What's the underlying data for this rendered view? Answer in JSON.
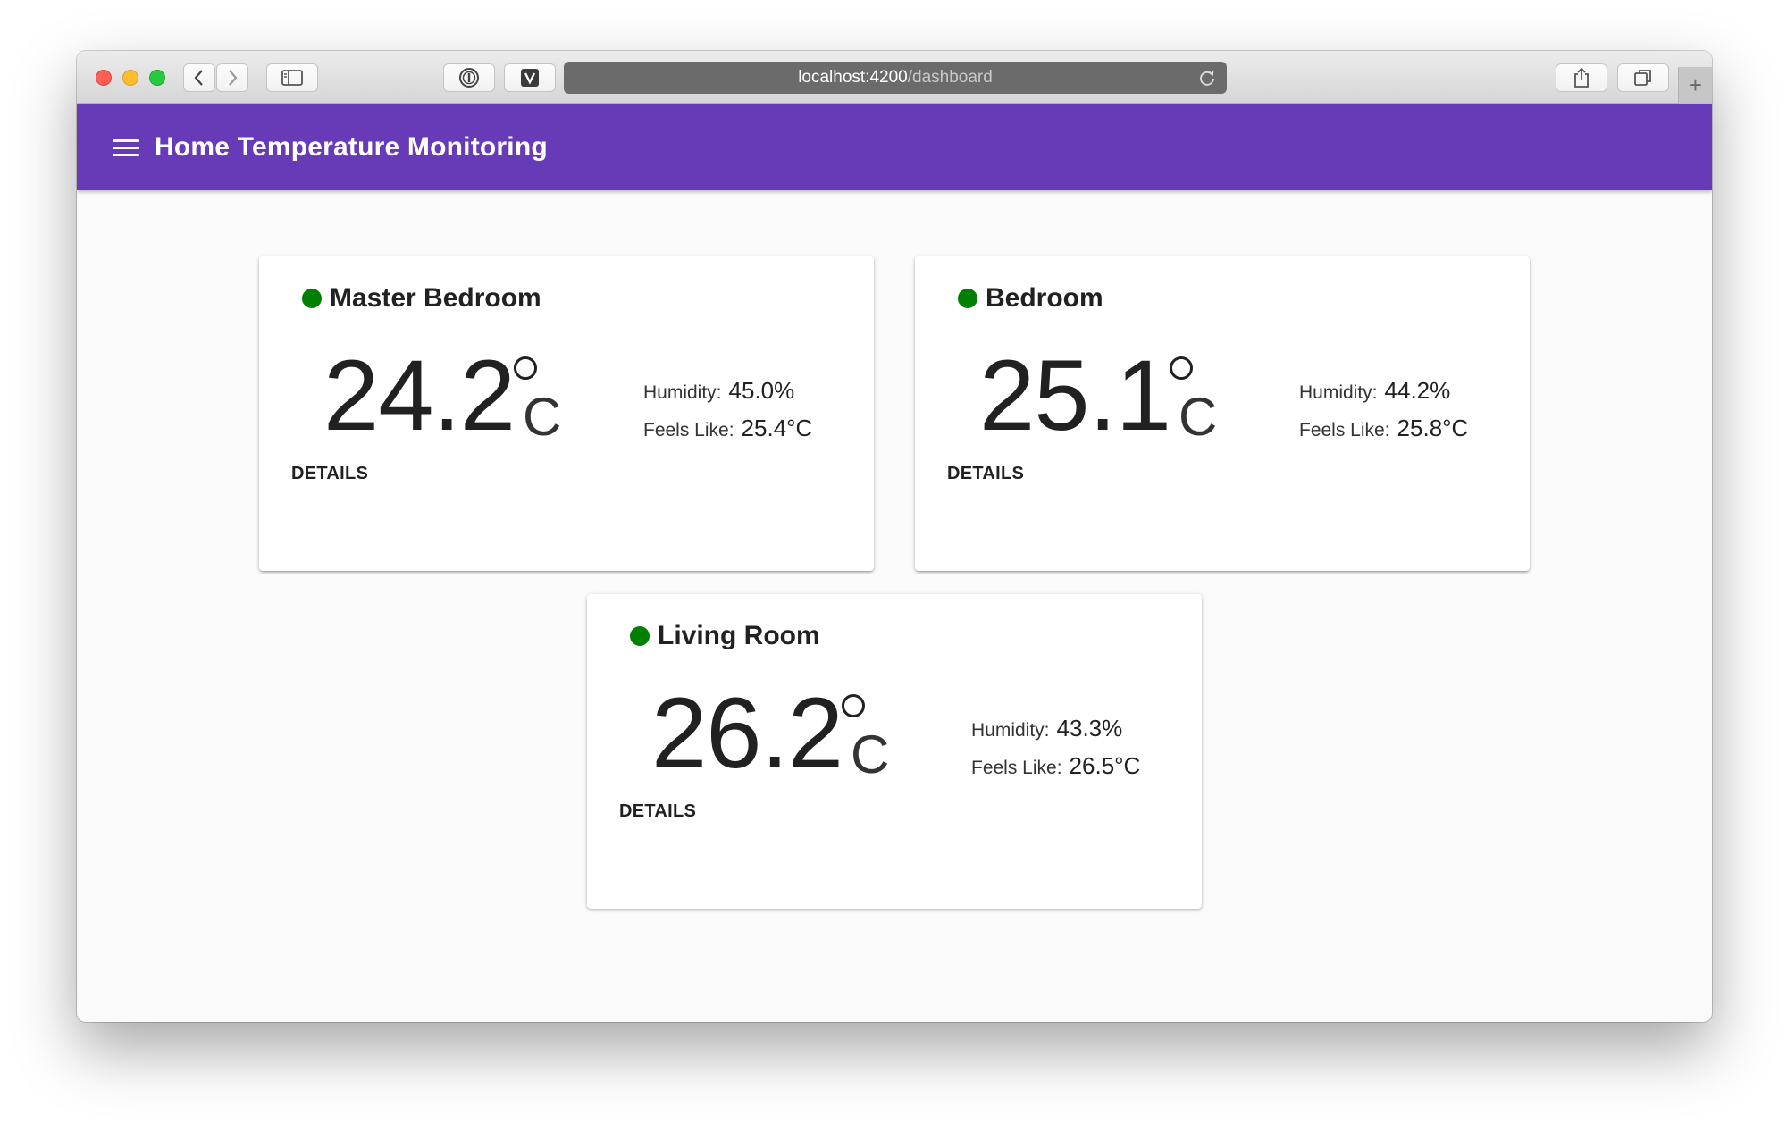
{
  "browser": {
    "url_host": "localhost:4200",
    "url_path": "/dashboard",
    "new_tab_label": "+"
  },
  "app": {
    "title": "Home Temperature Monitoring",
    "accent_color": "#673ab7",
    "status_color": "#008000"
  },
  "rooms": [
    {
      "name": "Master Bedroom",
      "temperature": "24.2",
      "unit": "C",
      "humidity_label": "Humidity:",
      "humidity": "45.0%",
      "feels_like_label": "Feels Like:",
      "feels_like": "25.4°C",
      "details_label": "DETAILS"
    },
    {
      "name": "Bedroom",
      "temperature": "25.1",
      "unit": "C",
      "humidity_label": "Humidity:",
      "humidity": "44.2%",
      "feels_like_label": "Feels Like:",
      "feels_like": "25.8°C",
      "details_label": "DETAILS"
    },
    {
      "name": "Living Room",
      "temperature": "26.2",
      "unit": "C",
      "humidity_label": "Humidity:",
      "humidity": "43.3%",
      "feels_like_label": "Feels Like:",
      "feels_like": "26.5°C",
      "details_label": "DETAILS"
    }
  ]
}
